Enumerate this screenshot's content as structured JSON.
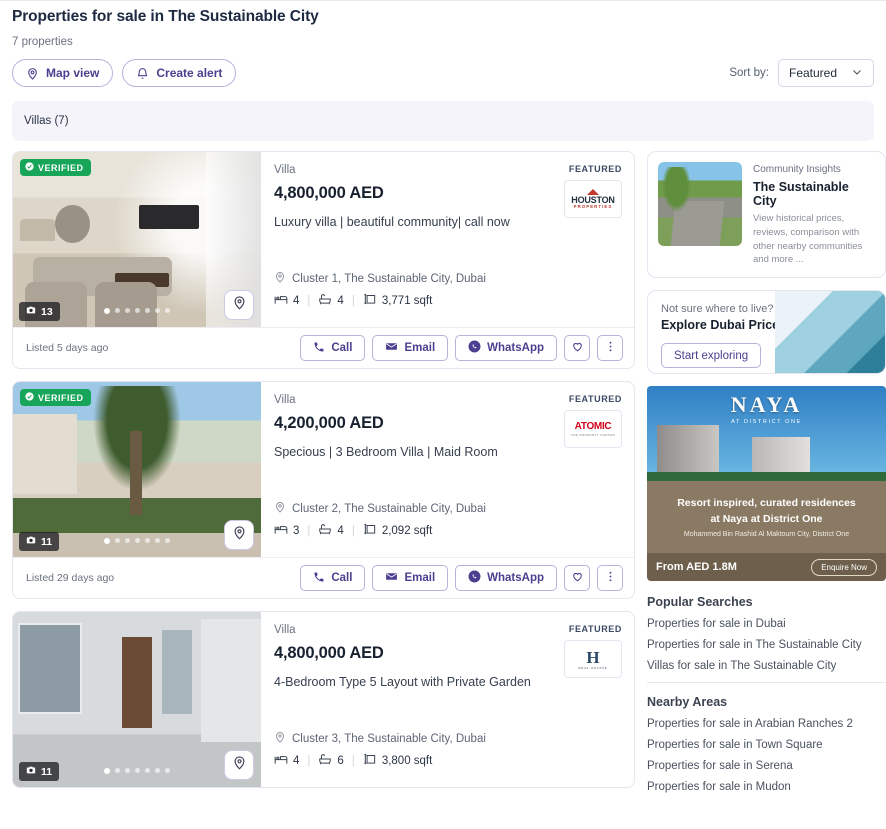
{
  "header": {
    "title": "Properties for sale in The Sustainable City",
    "count_text": "7 properties",
    "map_view_label": "Map view",
    "create_alert_label": "Create alert",
    "sort_label": "Sort by:",
    "sort_value": "Featured"
  },
  "filter_bar": {
    "chip": "Villas (7)"
  },
  "listings": [
    {
      "type": "Villa",
      "price": "4,800,000 AED",
      "title": "Luxury villa | beautiful community| call now",
      "location": "Cluster 1, The Sustainable City, Dubai",
      "beds": "4",
      "baths": "4",
      "area": "3,771 sqft",
      "featured": "FEATURED",
      "verified": "VERIFIED",
      "photos": "13",
      "listed": "Listed 5 days ago",
      "agency": "HOUSTON PROPERTIES",
      "agency_line1": "HOUSTON",
      "agency_line2": "PROPERTIES",
      "call": "Call",
      "email": "Email",
      "whatsapp": "WhatsApp"
    },
    {
      "type": "Villa",
      "price": "4,200,000 AED",
      "title": "Specious | 3 Bedroom Villa | Maid Room",
      "location": "Cluster 2, The Sustainable City, Dubai",
      "beds": "3",
      "baths": "4",
      "area": "2,092 sqft",
      "featured": "FEATURED",
      "verified": "VERIFIED",
      "photos": "11",
      "listed": "Listed 29 days ago",
      "agency": "ATOMIC",
      "agency_line1": "ATOMIC",
      "agency_line2": "THE PROPERTY CENTER",
      "call": "Call",
      "email": "Email",
      "whatsapp": "WhatsApp"
    },
    {
      "type": "Villa",
      "price": "4,800,000 AED",
      "title": "4-Bedroom Type 5 Layout with Private Garden",
      "location": "Cluster 3, The Sustainable City, Dubai",
      "beds": "4",
      "baths": "6",
      "area": "3,800 sqft",
      "featured": "FEATURED",
      "verified": "",
      "photos": "11",
      "listed": "",
      "agency": "H REAL ESTATE",
      "agency_line1": "H",
      "agency_line2": "REAL ESTATE",
      "call": "Call",
      "email": "Email",
      "whatsapp": "WhatsApp"
    }
  ],
  "sidebar": {
    "community_insights": {
      "kicker": "Community Insights",
      "title": "The Sustainable City",
      "desc": "View historical prices, reviews, comparison with other nearby communities and more ..."
    },
    "price_map": {
      "kicker": "Not sure where to live?",
      "title": "Explore Dubai Price Map",
      "button": "Start exploring"
    },
    "ad": {
      "brand": "NAYA",
      "brand_sub": "AT DISTRICT ONE",
      "line1": "Resort inspired, curated residences",
      "line2": "at Naya at District One",
      "line3": "Mohammed Bin Rashid Al Maktoum City, District One",
      "price": "From AED 1.8M",
      "cta": "Enquire Now"
    },
    "popular_searches": {
      "title": "Popular Searches",
      "items": [
        "Properties for sale in Dubai",
        "Properties for sale in The Sustainable City",
        "Villas for sale in The Sustainable City"
      ]
    },
    "nearby_areas": {
      "title": "Nearby Areas",
      "items": [
        "Properties for sale in Arabian Ranches 2",
        "Properties for sale in Town Square",
        "Properties for sale in Serena",
        "Properties for sale in Mudon"
      ]
    }
  },
  "colors": {
    "accent": "#4b3f8f",
    "verified_green": "#17a55a",
    "filter_bg": "#f5f4fa",
    "text_dark": "#18212f",
    "text_muted": "#6b7280"
  }
}
